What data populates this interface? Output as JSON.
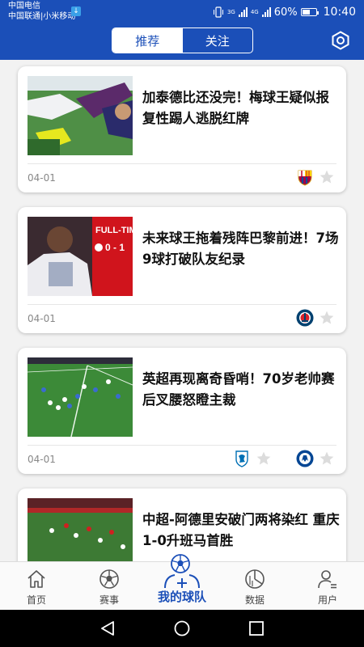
{
  "status_bar": {
    "carrier_primary": "中国电信",
    "carrier_secondary": "中国联通|小米移动",
    "network_a": "3G",
    "network_b": "4G",
    "battery_text": "60%",
    "battery_level": 0.6,
    "time": "10:40"
  },
  "header": {
    "tabs": [
      {
        "label": "推荐",
        "active": true
      },
      {
        "label": "关注",
        "active": false
      }
    ],
    "settings_icon": "hexagon-settings-icon"
  },
  "feed": [
    {
      "headline": "加泰德比还没完！梅球王疑似报复性踢人逃脱红牌",
      "date": "04-01",
      "teams": [
        {
          "badge": "barcelona-badge",
          "color": "#a50044"
        }
      ],
      "thumb": "player-kick-photo"
    },
    {
      "headline": "未来球王拖着残阵巴黎前进！7场9球打破队友纪录",
      "date": "04-01",
      "teams": [
        {
          "badge": "psg-badge",
          "color": "#004170"
        }
      ],
      "thumb": "mbappe-fulltime-photo",
      "thumb_overlay": {
        "title": "FULL-TIM",
        "score": "0 - 1"
      }
    },
    {
      "headline": "英超再现离奇昏哨！70岁老帅赛后叉腰怒瞪主裁",
      "date": "04-01",
      "teams": [
        {
          "badge": "cardiff-badge",
          "color": "#0070b5"
        },
        {
          "badge": "chelsea-badge",
          "color": "#034694"
        }
      ],
      "thumb": "premier-league-match-photo"
    },
    {
      "headline": "中超-阿德里安破门两将染红 重庆1-0升班马首胜",
      "date": "",
      "teams": [],
      "thumb": "csl-match-photo"
    }
  ],
  "tabbar": {
    "items": [
      {
        "label": "首页",
        "icon": "home-icon"
      },
      {
        "label": "赛事",
        "icon": "football-icon"
      },
      {
        "label": "我的球队",
        "icon": "my-team-icon",
        "center": true
      },
      {
        "label": "数据",
        "icon": "data-chart-icon"
      },
      {
        "label": "用户",
        "icon": "user-icon"
      }
    ]
  },
  "colors": {
    "brand": "#1b4fb8",
    "star": "#dcdcdc"
  }
}
